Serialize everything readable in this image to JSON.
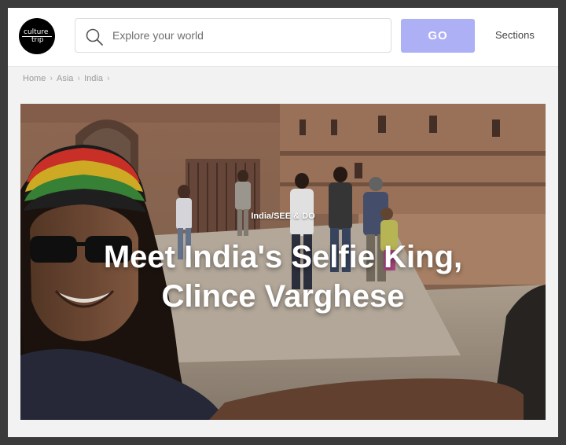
{
  "header": {
    "logo": {
      "line1": "culture",
      "line2": "trip"
    },
    "search": {
      "placeholder": "Explore your world",
      "value": ""
    },
    "go_label": "GO",
    "sections_label": "Sections"
  },
  "breadcrumb": [
    "Home",
    "Asia",
    "India"
  ],
  "breadcrumb_separator": "›",
  "hero": {
    "category_country": "India",
    "category_separator": "/",
    "category_section": "SEE & DO",
    "title_line1": "Meet India's Selfie King,",
    "title_line2": "Clince Varghese"
  },
  "colors": {
    "go_button": "#aeb0f5",
    "logo_background": "#000000",
    "page_background": "#f2f2f2"
  }
}
